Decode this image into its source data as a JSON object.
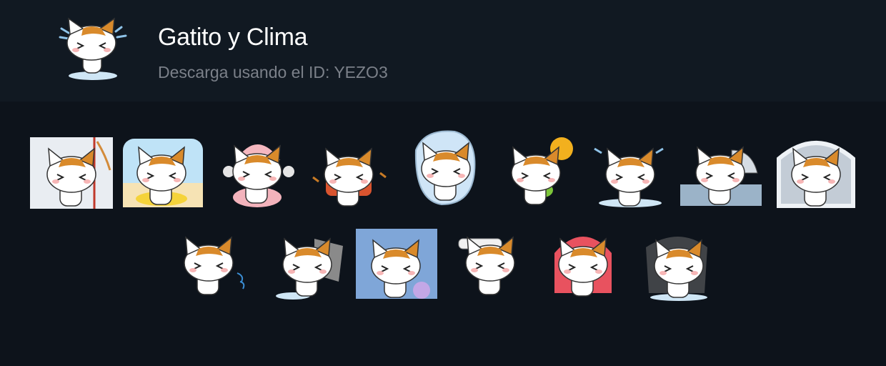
{
  "pack": {
    "title": "Gatito y Clima",
    "subtitle": "Descarga usando el ID: YEZO3",
    "icon": "cat-shivering-icon"
  },
  "stickers": [
    {
      "name": "sticker-cat-winter-window",
      "scene": "winter-window"
    },
    {
      "name": "sticker-cat-beach-float",
      "scene": "beach"
    },
    {
      "name": "sticker-cat-pink-hat-cocoa",
      "scene": "pink-hat"
    },
    {
      "name": "sticker-cat-scarf-autumn",
      "scene": "scarf"
    },
    {
      "name": "sticker-cat-frozen-ice",
      "scene": "ice"
    },
    {
      "name": "sticker-cat-hot-sun",
      "scene": "sun"
    },
    {
      "name": "sticker-cat-shivering",
      "scene": "shiver"
    },
    {
      "name": "sticker-cat-umbrella-rain",
      "scene": "umbrella"
    },
    {
      "name": "sticker-cat-window-rain",
      "scene": "rain-window"
    },
    {
      "name": "sticker-cat-sneezing",
      "scene": "sneeze"
    },
    {
      "name": "sticker-cat-windy",
      "scene": "wind"
    },
    {
      "name": "sticker-cat-rain-flowers",
      "scene": "flowers"
    },
    {
      "name": "sticker-cat-fever-cloth",
      "scene": "fever"
    },
    {
      "name": "sticker-cat-red-hood",
      "scene": "hood"
    },
    {
      "name": "sticker-cat-storm",
      "scene": "storm"
    }
  ]
}
